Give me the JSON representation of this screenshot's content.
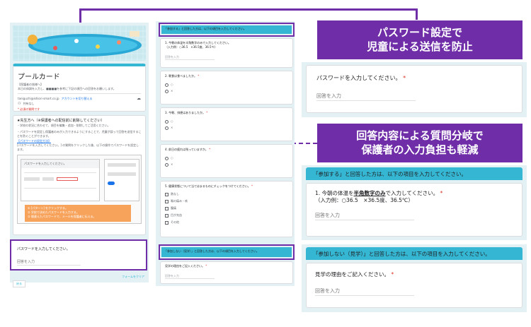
{
  "callouts": {
    "password": [
      "パスワード設定で",
      "児童による送信を防止"
    ],
    "branching": [
      "回答内容による質問分岐で",
      "保護者の入力負担も軽減"
    ]
  },
  "form": {
    "title": "プールカード",
    "desc_line1": "【保護者の皆様へ】",
    "desc_line2": "本日の体調を入力し、■■■■を参考に下記の項目への回答をお願いします。",
    "account_email": "taniguchi@ishiori-smart.co.jp",
    "switch_account": "アカウントを切り替える",
    "not_shared": "共有なし",
    "required_note": "* 必須の質問です",
    "notice_title": "★先生方へ（※保護者への配信前に削除してください）",
    "notice_lines": [
      "・学校の状況に合わせて、項目を編集・追加・削除してご活用ください。",
      "・パスワードを設定し保護者のみが入力できるようにすることで、児童が誤って回答を送信することを防ぐことができます。",
      "【パスワードの設定方法】",
      "[パスワードを入力してください。] の質問をクリックした後、以下の操作でパスワードを設定します。"
    ],
    "inset_question": "パスワードを入力してください。",
    "inset_steps": [
      "① [パターン] をクリックする。",
      "② 学校で決めたパスワードを入力する。",
      "③ 間違えたパスワードで、メールを保護者に伝える。"
    ],
    "password_question": "パスワードを入力してください。",
    "answer_placeholder": "回答を入力",
    "back_button": "戻る",
    "clear_button": "フォームをクリア"
  },
  "middle": {
    "section_attend": "「参加する」と回答した方は、以下の項目を入力してください。",
    "q1": "1. 今朝の体温を半角数字のみで入力してください。",
    "q1_example": "（入力例：○36.5　×36.5度、36.5℃）",
    "q2": "2. 朝食は食べましたか。",
    "q3": "3. 今朝、排便はありましたか。",
    "q4": "4. 前日の疲れは残っていますか。",
    "q5": "5. 健康状態について当てはまるものにチェックをつけてください。",
    "opt_yes": "○",
    "opt_no": "×",
    "check_options": [
      "熱なし",
      "喉の痛み・咳",
      "腹痛",
      "目が充血",
      "その他"
    ],
    "section_observe": "「参加しない（見学）」と回答した方は、以下の項目を入力してください。",
    "observe_question": "見学の理由をご記入ください。"
  },
  "right": {
    "password_question": "パスワードを入力してください。",
    "answer_placeholder": "回答を入力",
    "section_attend": "「参加する」と回答した方は、以下の項目を入力してください。",
    "q1_prefix": "1. 今朝の体温を",
    "q1_emph": "半角数字のみ",
    "q1_suffix": "で入力してください。",
    "q1_example": "（入力例：○36.5　×36.5度、36.5℃）",
    "section_observe": "「参加しない（見学）」と回答した方は、以下の項目を入力してください。",
    "observe_question": "見学の理由をご記入ください。"
  },
  "colors": {
    "accent_purple": "#6f2da8",
    "section_cyan": "#35b7d3",
    "required_red": "#d93025"
  }
}
